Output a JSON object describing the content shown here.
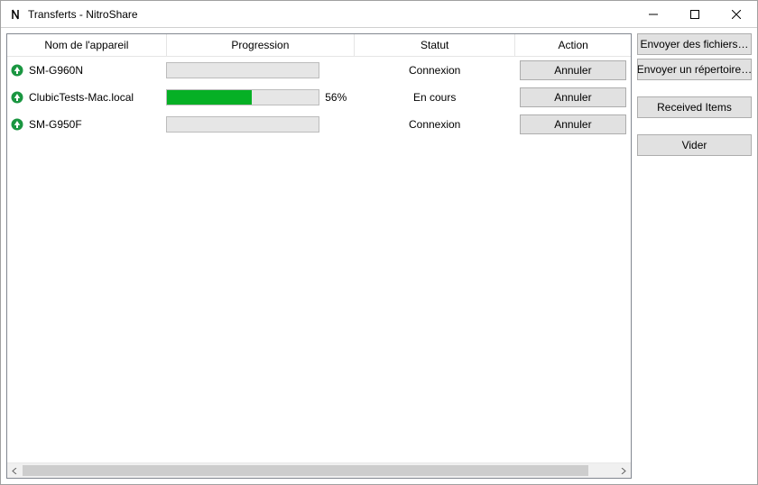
{
  "window": {
    "title": "Transferts - NitroShare"
  },
  "columns": {
    "device": "Nom de l'appareil",
    "progress": "Progression",
    "status": "Statut",
    "action": "Action"
  },
  "transfers": [
    {
      "direction": "upload",
      "device": "SM-G960N",
      "progress_pct": 0,
      "progress_label": "",
      "status": "Connexion",
      "action_label": "Annuler"
    },
    {
      "direction": "upload",
      "device": "ClubicTests-Mac.local",
      "progress_pct": 56,
      "progress_label": "56%",
      "status": "En cours",
      "action_label": "Annuler"
    },
    {
      "direction": "upload",
      "device": "SM-G950F",
      "progress_pct": 0,
      "progress_label": "",
      "status": "Connexion",
      "action_label": "Annuler"
    }
  ],
  "sidebar": {
    "send_files": "Envoyer des fichiers…",
    "send_dir": "Envoyer un répertoire…",
    "received_items": "Received Items",
    "clear": "Vider"
  },
  "colors": {
    "progress_fill": "#06b025"
  }
}
